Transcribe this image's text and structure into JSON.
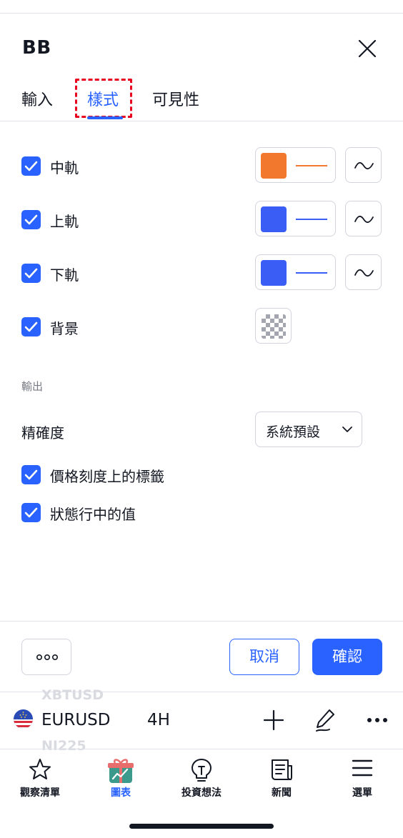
{
  "dialog": {
    "title": "BB",
    "tabs": [
      {
        "label": "輸入",
        "active": false
      },
      {
        "label": "樣式",
        "active": true
      },
      {
        "label": "可見性",
        "active": false
      }
    ]
  },
  "style_rows": [
    {
      "label": "中軌",
      "checked": true,
      "color": "#f2782d"
    },
    {
      "label": "上軌",
      "checked": true,
      "color": "#3a5ef5"
    },
    {
      "label": "下軌",
      "checked": true,
      "color": "#3a5ef5"
    },
    {
      "label": "背景",
      "checked": true
    }
  ],
  "output": {
    "section_title": "輸出",
    "precision_label": "精確度",
    "precision_value": "系統預設",
    "options": [
      {
        "label": "價格刻度上的標籤",
        "checked": true
      },
      {
        "label": "狀態行中的值",
        "checked": true
      }
    ]
  },
  "footer": {
    "cancel_label": "取消",
    "ok_label": "確認"
  },
  "chart_bar": {
    "ghost_top": "XBTUSD",
    "ghost_bottom": "NI225",
    "symbol": "EURUSD",
    "interval": "4H"
  },
  "nav": [
    {
      "label": "觀察清單",
      "icon": "star-icon",
      "active": false
    },
    {
      "label": "圖表",
      "icon": "chart-gift-icon",
      "active": true
    },
    {
      "label": "投資想法",
      "icon": "lightbulb-icon",
      "active": false
    },
    {
      "label": "新聞",
      "icon": "news-icon",
      "active": false
    },
    {
      "label": "選單",
      "icon": "menu-icon",
      "active": false
    }
  ],
  "colors": {
    "accent": "#2962ff",
    "orange": "#f2782d",
    "highlight_box": "#e8001f"
  }
}
